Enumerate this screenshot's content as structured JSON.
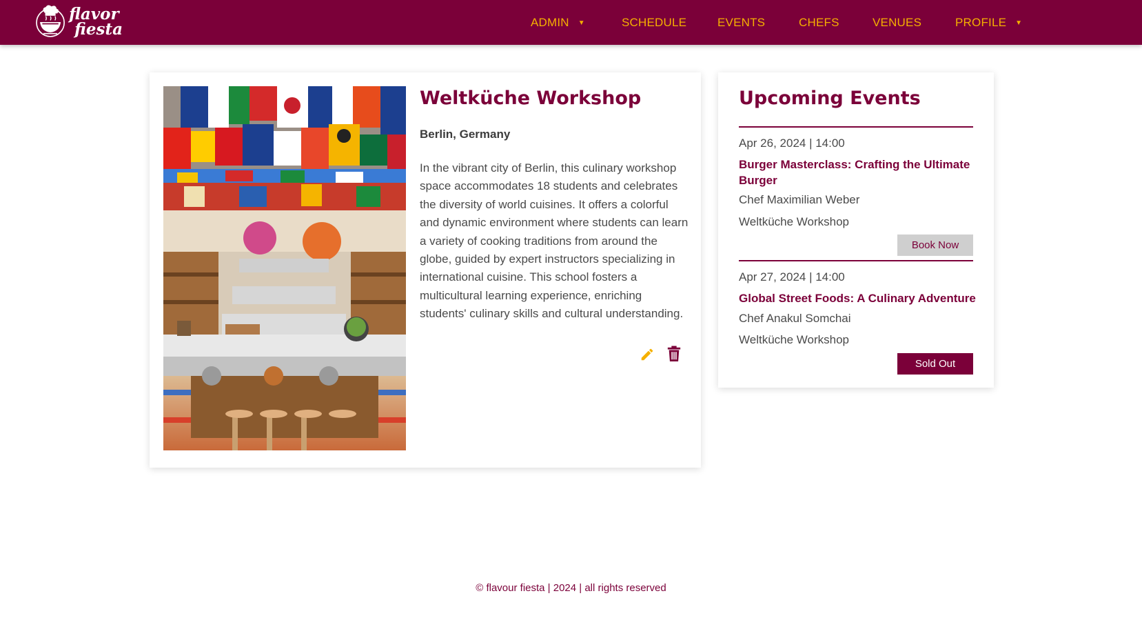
{
  "brand": {
    "logo_line1": "flavor",
    "logo_line2": "fiesta"
  },
  "nav": {
    "items": [
      {
        "label": "ADMIN",
        "has_dropdown": true
      },
      {
        "label": "SCHEDULE",
        "has_dropdown": false
      },
      {
        "label": "EVENTS",
        "has_dropdown": false
      },
      {
        "label": "CHEFS",
        "has_dropdown": false
      },
      {
        "label": "VENUES",
        "has_dropdown": false
      },
      {
        "label": "PROFILE",
        "has_dropdown": true
      }
    ],
    "caret": "▼"
  },
  "venue": {
    "title": "Weltküche Workshop",
    "location": "Berlin, Germany",
    "description": "In the vibrant city of Berlin, this culinary workshop space accommodates 18 students and celebrates the diversity of world cuisines. It offers a colorful and dynamic environment where students can learn a variety of cooking traditions from around the globe, guided by expert instructors specializing in international cuisine. This school fosters a multicultural learning experience, enriching students' culinary skills and cultural understanding.",
    "actions": {
      "edit_icon": "pencil-icon",
      "delete_icon": "trash-icon"
    }
  },
  "upcoming": {
    "title": "Upcoming Events",
    "events": [
      {
        "date": "Apr 26, 2024 | 14:00",
        "name": "Burger Masterclass: Crafting the Ultimate Burger",
        "chef": "Chef Maximilian Weber",
        "venue": "Weltküche Workshop",
        "button": "Book Now"
      },
      {
        "date": "Apr 27, 2024 | 14:00",
        "name": "Global Street Foods: A Culinary Adventure",
        "chef": "Chef Anakul Somchai",
        "venue": "Weltküche Workshop",
        "button": "Sold Out"
      }
    ]
  },
  "footer": {
    "text": "© flavour fiesta | 2024 | all rights reserved"
  },
  "colors": {
    "primary": "#7b0039",
    "nav_text": "#f5b000",
    "edit_icon": "#f5b000",
    "book_button_bg": "#cfcfcf"
  }
}
